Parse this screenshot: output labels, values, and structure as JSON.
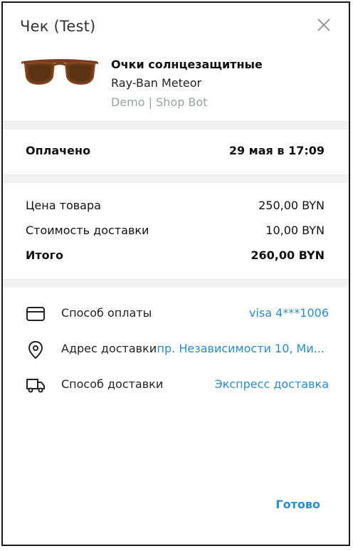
{
  "header": {
    "title": "Чек (Test)",
    "close_icon": "close-icon"
  },
  "product": {
    "image": "sunglasses-image",
    "title": "Очки солнцезащитные",
    "description": "Ray-Ban Meteor",
    "shop": "Demo | Shop Bot"
  },
  "status": {
    "label": "Оплачено",
    "value": "29 мая в 17:09"
  },
  "prices": {
    "items": [
      {
        "label": "Цена товара",
        "value": "250,00 BYN"
      },
      {
        "label": "Стоимость доставки",
        "value": "10,00 BYN"
      }
    ],
    "total": {
      "label": "Итого",
      "value": "260,00 BYN"
    }
  },
  "details": [
    {
      "icon": "credit-card-icon",
      "label": "Способ оплаты",
      "value": "visa 4***1006"
    },
    {
      "icon": "location-pin-icon",
      "label": "Адрес доставки",
      "value": "пр. Независимости 10, Ми..."
    },
    {
      "icon": "delivery-truck-icon",
      "label": "Способ доставки",
      "value": "Экспресс доставка"
    }
  ],
  "footer": {
    "done_label": "Готово"
  },
  "colors": {
    "accent": "#2a8bd0",
    "muted": "#9aa0a6",
    "divider": "#f1f1f1"
  }
}
